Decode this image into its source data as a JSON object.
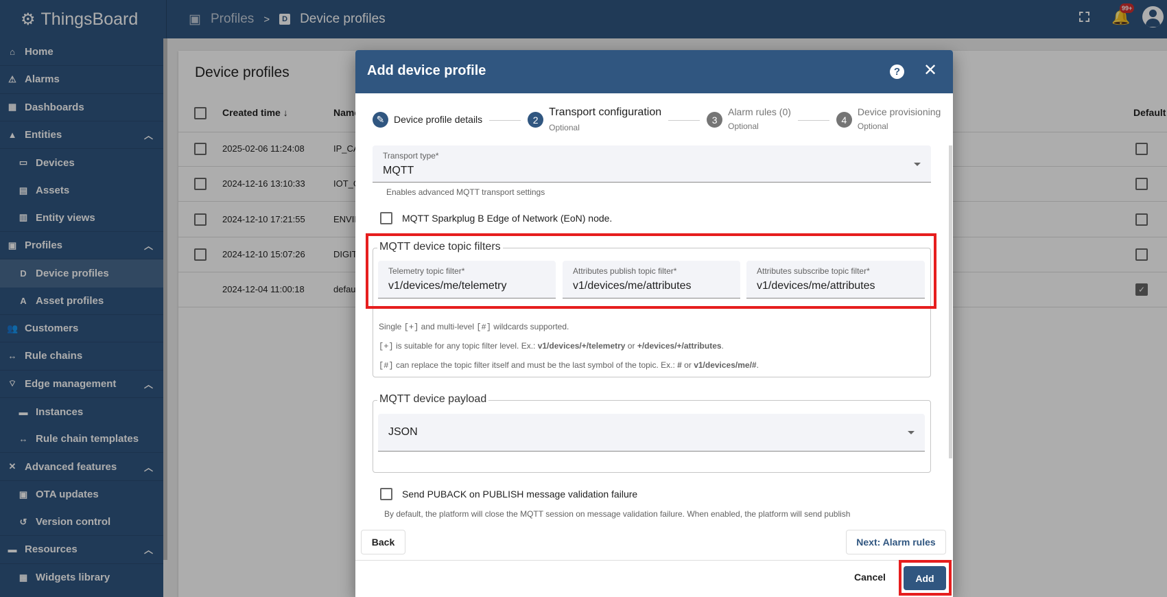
{
  "app": {
    "name": "ThingsBoard"
  },
  "breadcrumb": [
    {
      "label": "Profiles"
    },
    {
      "label": "Device profiles",
      "icon": "D"
    }
  ],
  "topbar": {
    "notification_count": "99+"
  },
  "sidebar": {
    "items": [
      {
        "label": "Home",
        "icon": "home-icon",
        "glyph": "⌂"
      },
      {
        "label": "Alarms",
        "icon": "alarm-warning-icon",
        "glyph": "⚠"
      },
      {
        "label": "Dashboards",
        "icon": "dashboards-icon",
        "glyph": "▦"
      },
      {
        "label": "Entities",
        "icon": "entities-icon",
        "glyph": "▲",
        "expanded": true
      },
      {
        "label": "Devices",
        "icon": "devices-icon",
        "glyph": "▭",
        "sub": true
      },
      {
        "label": "Assets",
        "icon": "assets-icon",
        "glyph": "▤",
        "sub": true
      },
      {
        "label": "Entity views",
        "icon": "entity-views-icon",
        "glyph": "▥",
        "sub": true,
        "last": true
      },
      {
        "label": "Profiles",
        "icon": "profiles-icon",
        "glyph": "▣",
        "expanded": true
      },
      {
        "label": "Device profiles",
        "icon": "device-profile-icon",
        "glyph": "D",
        "sub": true,
        "active": true
      },
      {
        "label": "Asset profiles",
        "icon": "asset-profile-icon",
        "glyph": "A",
        "sub": true,
        "last": true
      },
      {
        "label": "Customers",
        "icon": "customers-icon",
        "glyph": "👥"
      },
      {
        "label": "Rule chains",
        "icon": "rule-chains-icon",
        "glyph": "↔"
      },
      {
        "label": "Edge management",
        "icon": "edge-icon",
        "glyph": "⌔",
        "expanded": true
      },
      {
        "label": "Instances",
        "icon": "instances-icon",
        "glyph": "▬",
        "sub": true
      },
      {
        "label": "Rule chain templates",
        "icon": "rule-chain-templates-icon",
        "glyph": "↔",
        "sub": true,
        "last": true
      },
      {
        "label": "Advanced features",
        "icon": "tools-icon",
        "glyph": "✕",
        "expanded": true
      },
      {
        "label": "OTA updates",
        "icon": "chip-icon",
        "glyph": "▣",
        "sub": true
      },
      {
        "label": "Version control",
        "icon": "history-icon",
        "glyph": "↺",
        "sub": true,
        "last": true
      },
      {
        "label": "Resources",
        "icon": "folder-icon",
        "glyph": "▬",
        "expanded": true
      },
      {
        "label": "Widgets library",
        "icon": "widgets-icon",
        "glyph": "▦",
        "sub": true
      }
    ]
  },
  "page": {
    "title": "Device profiles",
    "columns": {
      "created": "Created time",
      "name": "Name",
      "default": "Default"
    },
    "rows": [
      {
        "created": "2025-02-06 11:24:08",
        "name": "IP_CA",
        "default": false
      },
      {
        "created": "2024-12-16 13:10:33",
        "name": "IOT_G",
        "default": false
      },
      {
        "created": "2024-12-10 17:21:55",
        "name": "ENVIR",
        "default": false
      },
      {
        "created": "2024-12-10 15:07:26",
        "name": "DIGIT",
        "default": false
      },
      {
        "created": "2024-12-04 11:00:18",
        "name": "defau",
        "default": true
      }
    ]
  },
  "dialog": {
    "title": "Add device profile",
    "steps": [
      {
        "num": "1",
        "label": "Device profile details",
        "optional": "",
        "state": "done"
      },
      {
        "num": "2",
        "label": "Transport configuration",
        "optional": "Optional",
        "state": "active"
      },
      {
        "num": "3",
        "label": "Alarm rules (0)",
        "optional": "Optional",
        "state": "pending"
      },
      {
        "num": "4",
        "label": "Device provisioning",
        "optional": "Optional",
        "state": "pending"
      }
    ],
    "transport_type": {
      "label": "Transport type*",
      "value": "MQTT",
      "hint": "Enables advanced MQTT transport settings"
    },
    "sparkplug": {
      "label": "MQTT Sparkplug B Edge of Network (EoN) node.",
      "checked": false
    },
    "topic_filters": {
      "legend": "MQTT device topic filters",
      "telemetry": {
        "label": "Telemetry topic filter*",
        "value": "v1/devices/me/telemetry"
      },
      "attr_publish": {
        "label": "Attributes publish topic filter*",
        "value": "v1/devices/me/attributes"
      },
      "attr_subscribe": {
        "label": "Attributes subscribe topic filter*",
        "value": "v1/devices/me/attributes"
      },
      "help1_a": "Single ",
      "help1_b": "[+]",
      "help1_c": " and multi-level ",
      "help1_d": "[#]",
      "help1_e": " wildcards supported.",
      "help2_a": "[+]",
      "help2_b": " is suitable for any topic filter level. Ex.: ",
      "help2_c": "v1/devices/+/telemetry",
      "help2_d": " or ",
      "help2_e": "+/devices/+/attributes",
      "help2_f": ".",
      "help3_a": "[#]",
      "help3_b": " can replace the topic filter itself and must be the last symbol of the topic. Ex.: ",
      "help3_c": "#",
      "help3_d": " or ",
      "help3_e": "v1/devices/me/#",
      "help3_f": "."
    },
    "payload": {
      "legend": "MQTT device payload",
      "value": "JSON"
    },
    "puback": {
      "label": "Send PUBACK on PUBLISH message validation failure",
      "checked": false,
      "desc": "By default, the platform will close the MQTT session on message validation failure. When enabled, the platform will send publish"
    },
    "back": "Back",
    "next": "Next: Alarm rules",
    "cancel": "Cancel",
    "add": "Add"
  },
  "colors": {
    "primary": "#305680",
    "highlight": "#e61e1e",
    "badge": "#d32f2f"
  }
}
